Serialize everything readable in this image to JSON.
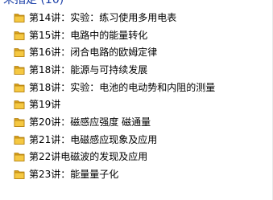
{
  "header": {
    "title": "未指定 (10)"
  },
  "icons": {
    "folder": "folder-icon"
  },
  "colors": {
    "folder_back": "#d9a21b",
    "folder_front": "#f5c842",
    "folder_edge": "#b37f0d",
    "header_text": "#1a3fa8"
  },
  "items": [
    {
      "label": "第14讲：实验：练习使用多用电表"
    },
    {
      "label": "第15讲：电路中的能量转化"
    },
    {
      "label": "第16讲：闭合电路的欧姆定律"
    },
    {
      "label": "第18讲：能源与可持续发展"
    },
    {
      "label": "第18讲：实验：电池的电动势和内阻的测量"
    },
    {
      "label": "第19讲"
    },
    {
      "label": "第20讲：磁感应强度 磁通量"
    },
    {
      "label": "第21讲：电磁感应现象及应用"
    },
    {
      "label": "第22讲电磁波的发现及应用"
    },
    {
      "label": "第23讲：能量量子化"
    }
  ]
}
